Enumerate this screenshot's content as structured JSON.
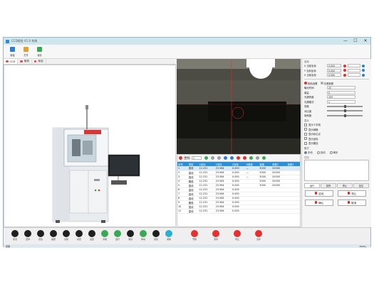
{
  "window": {
    "title": "CCD视觉 V1.0 系统",
    "controls": [
      "—",
      "☐",
      "✕"
    ]
  },
  "toolbar": {
    "buttons": [
      {
        "label": "新建",
        "icon": "new-doc-icon",
        "color": "#2a7fd0"
      },
      {
        "label": "打开",
        "icon": "open-folder-icon",
        "color": "#e0a030"
      },
      {
        "label": "保存",
        "icon": "save-icon",
        "color": "#3aa856"
      }
    ]
  },
  "tabs": [
    {
      "label": "CCD",
      "color": "#e44"
    },
    {
      "label": "相机",
      "color": "#e44"
    },
    {
      "label": "标定",
      "color": "#e44"
    }
  ],
  "camera": {
    "crosshair_color": "#e53030"
  },
  "grid_toolbar": {
    "label": "坐标",
    "field": "1",
    "icons": [
      "#3aa856",
      "#9aa0a6",
      "#9aa0a6",
      "#2a7fd0",
      "#2a7fd0",
      "#e53030",
      "#e53030",
      "#3aa856",
      "#9aa0a6",
      "#3aa856"
    ]
  },
  "grid": {
    "columns": [
      "序号",
      "类型",
      "X坐标",
      "Y坐标",
      "Z坐标",
      "R角度",
      "速度",
      "参数1",
      "参数2"
    ],
    "rows": [
      [
        "1",
        "直线",
        "12.231",
        "23.564",
        "0.000",
        "—",
        "3000",
        "20000",
        ""
      ],
      [
        "2",
        "直线",
        "12.231",
        "23.564",
        "0.000",
        "—",
        "3000",
        "20000",
        ""
      ],
      [
        "3",
        "直线",
        "12.231",
        "23.564",
        "0.000",
        "—",
        "3000",
        "20000",
        ""
      ],
      [
        "4",
        "圆弧",
        "12.231",
        "23.564",
        "0.000",
        "",
        "3000",
        "20000",
        ""
      ],
      [
        "5",
        "直线",
        "12.231",
        "23.564",
        "0.000",
        "",
        "3000",
        "20000",
        ""
      ],
      [
        "6",
        "直线",
        "12.231",
        "23.564",
        "0.000",
        "",
        "",
        "",
        ""
      ],
      [
        "7",
        "直线",
        "12.231",
        "23.564",
        "0.000",
        "",
        "",
        "",
        ""
      ],
      [
        "8",
        "直线",
        "12.231",
        "23.564",
        "0.000",
        "",
        "",
        "",
        ""
      ],
      [
        "9",
        "圆弧",
        "12.231",
        "23.564",
        "0.000",
        "",
        "",
        "",
        ""
      ],
      [
        "10",
        "直线",
        "12.231",
        "23.564",
        "0.000",
        "",
        "",
        "",
        ""
      ],
      [
        "11",
        "直线",
        "12.231",
        "23.564",
        "0.000",
        "",
        "",
        "",
        ""
      ]
    ]
  },
  "right_panel": {
    "section1_title": "坐标",
    "rows1": [
      {
        "label": "X 当前坐标",
        "value": "0.000"
      },
      {
        "label": "Y 当前坐标",
        "value": "0.000"
      },
      {
        "label": "Z 当前坐标",
        "value": "0.000"
      }
    ],
    "tabs": [
      "相机设置",
      "光源参数"
    ],
    "rows2": [
      {
        "label": "曝光时间",
        "value": "20"
      },
      {
        "label": "增益",
        "value": "0"
      },
      {
        "label": "光源亮度",
        "value": "255"
      },
      {
        "label": "光源模式",
        "value": "1"
      }
    ],
    "slider_rows": [
      "亮度",
      "对比度",
      "饱和度"
    ],
    "checkbox_title": "显示",
    "checkboxes": [
      "显示十字线",
      "显示网格",
      "显示标记点",
      "显示坐标",
      "显示路径"
    ],
    "section3_title": "模式",
    "radios": [
      "手动",
      "自动",
      "单步"
    ],
    "log_title": "日志",
    "bottom_tabs": [
      "运行",
      "暂停",
      "停止",
      "复位"
    ],
    "buttons": [
      {
        "label": "启动",
        "color": "#e53030"
      },
      {
        "label": "停止",
        "color": "#e53030"
      },
      {
        "label": "确认",
        "color": "#e53030"
      },
      {
        "label": "取消",
        "color": "#e53030"
      }
    ],
    "footer": "Ready"
  },
  "bottom_icons": [
    {
      "label": "原点",
      "color": "#1f1f1f"
    },
    {
      "label": "回零",
      "color": "#1f1f1f"
    },
    {
      "label": "定位",
      "color": "#1f1f1f"
    },
    {
      "label": "拍照",
      "color": "#1f1f1f"
    },
    {
      "label": "识别",
      "color": "#1f1f1f"
    },
    {
      "label": "标定",
      "color": "#1f1f1f"
    },
    {
      "label": "设置",
      "color": "#1f1f1f"
    },
    {
      "label": "对准",
      "color": "#3aa856"
    },
    {
      "label": "运行",
      "color": "#3aa856"
    },
    {
      "label": "测试",
      "color": "#1f1f1f"
    },
    {
      "label": "移动",
      "color": "#3aa856"
    },
    {
      "label": "复位",
      "color": "#1f1f1f"
    },
    {
      "label": "帮助",
      "color": "#2bb0d0"
    },
    {
      "label": "开始",
      "color": "#e53030"
    },
    {
      "label": "暂停",
      "color": "#e53030"
    },
    {
      "label": "停止",
      "color": "#e53030"
    },
    {
      "label": "急停",
      "color": "#e53030"
    }
  ],
  "statusbar": {
    "left": "就绪",
    "right": "Ready"
  }
}
